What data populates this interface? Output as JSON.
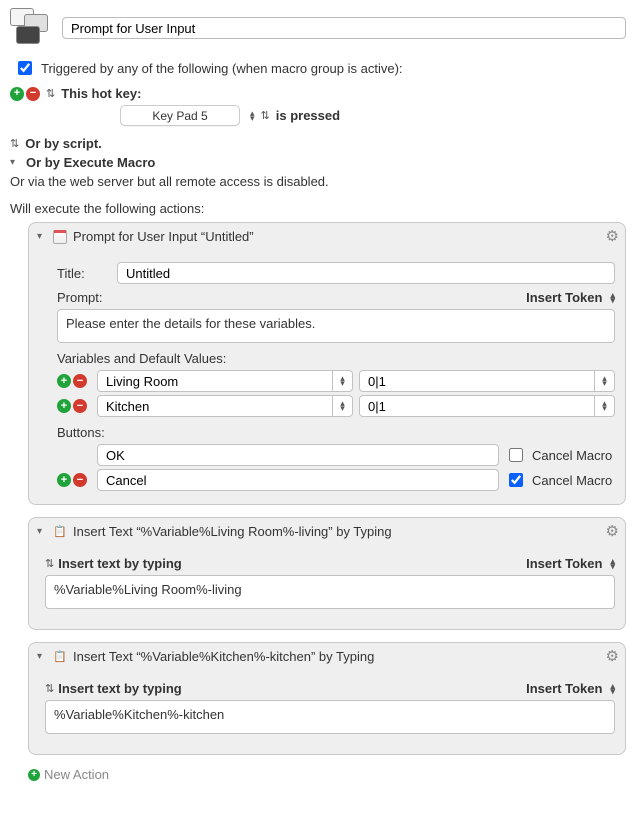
{
  "macro_name": "Prompt for User Input",
  "trigger_heading": "Triggered by any of the following (when macro group is active):",
  "trigger": {
    "this_hotkey": "This hot key:",
    "hotkey": "Key Pad 5",
    "is_pressed": "is pressed",
    "or_script": "Or by script.",
    "or_execute": "Or by Execute Macro",
    "or_web": "Or via the web server but all remote access is disabled."
  },
  "will_execute": "Will execute the following actions:",
  "action1": {
    "title": "Prompt for User Input “Untitled”",
    "title_label": "Title:",
    "title_value": "Untitled",
    "prompt_label": "Prompt:",
    "insert_token": "Insert Token",
    "prompt_text": "Please enter the details for these variables.",
    "vars_label": "Variables and Default Values:",
    "vars": [
      {
        "name": "Living Room",
        "default": "0|1"
      },
      {
        "name": "Kitchen",
        "default": "0|1"
      }
    ],
    "buttons_label": "Buttons:",
    "buttons": [
      {
        "name": "OK",
        "cancel": false,
        "has_addremove": false
      },
      {
        "name": "Cancel",
        "cancel": true,
        "has_addremove": true
      }
    ],
    "cancel_label": "Cancel Macro"
  },
  "action2": {
    "title": "Insert Text “%Variable%Living Room%-living” by Typing",
    "mode": "Insert text by typing",
    "insert_token": "Insert Token",
    "text": "%Variable%Living Room%-living"
  },
  "action3": {
    "title": "Insert Text “%Variable%Kitchen%-kitchen” by Typing",
    "mode": "Insert text by typing",
    "insert_token": "Insert Token",
    "text": "%Variable%Kitchen%-kitchen"
  },
  "new_action": "New Action"
}
